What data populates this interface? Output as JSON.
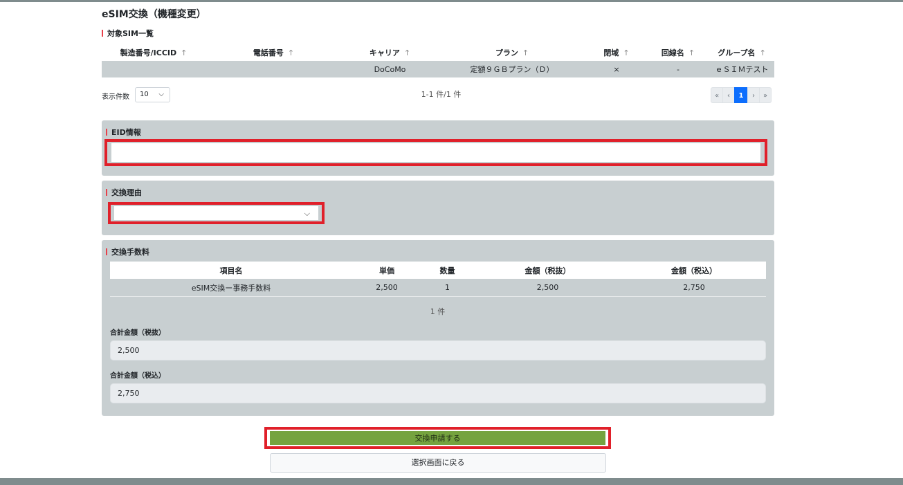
{
  "page": {
    "title": "eSIM交換（機種変更）"
  },
  "sim_list": {
    "section_label": "対象SIM一覧",
    "sort_icon": "↑",
    "columns": [
      "製造番号/ICCID",
      "電話番号",
      "キャリア",
      "プラン",
      "閉域",
      "回線名",
      "グループ名"
    ],
    "rows": [
      [
        "",
        "",
        "DoCoMo",
        "定額９ＧＢプラン（Ｄ）",
        "×",
        "-",
        "ｅＳＩＭテスト"
      ]
    ],
    "page_size_label": "表示件数",
    "page_size_value": "10",
    "range_text": "1-1 件/1 件",
    "pagination": {
      "first": "«",
      "prev": "‹",
      "current": "1",
      "next": "›",
      "last": "»"
    }
  },
  "eid": {
    "section_label": "EID情報",
    "value": ""
  },
  "reason": {
    "section_label": "交換理由",
    "selected": ""
  },
  "fee": {
    "section_label": "交換手数料",
    "columns": [
      "項目名",
      "単価",
      "数量",
      "金額（税抜）",
      "金額（税込）"
    ],
    "rows": [
      [
        "eSIM交換ー事務手数料",
        "2,500",
        "1",
        "2,500",
        "2,750"
      ]
    ],
    "count_text": "1 件",
    "total_excl_label": "合計金額（税抜）",
    "total_excl_value": "2,500",
    "total_incl_label": "合計金額（税込）",
    "total_incl_value": "2,750"
  },
  "actions": {
    "submit_label": "交換申請する",
    "back_label": "選択画面に戻る"
  },
  "colors": {
    "accent_red": "#e0202a",
    "submit_green": "#75a33f",
    "panel_gray": "#c8cfd1",
    "active_blue": "#0d6efd"
  }
}
